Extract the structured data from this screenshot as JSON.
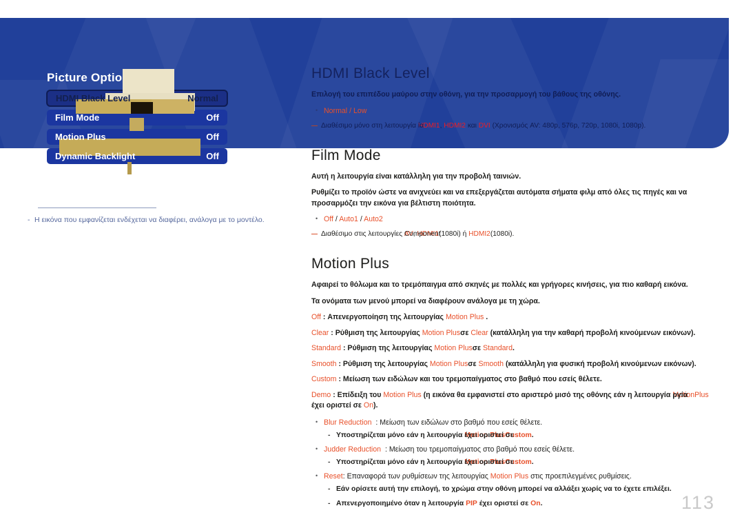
{
  "page": {
    "number": "113"
  },
  "osd": {
    "title": "Picture Options",
    "rows": [
      {
        "label": "HDMI Black Level",
        "value": "Normal",
        "selected": true
      },
      {
        "label": "Film Mode",
        "value": "Off",
        "selected": false
      },
      {
        "label": "Motion Plus",
        "value": "Off",
        "selected": false
      },
      {
        "label": "Dynamic Backlight",
        "value": "Off",
        "selected": false
      }
    ]
  },
  "left_note": {
    "dash": "-",
    "text": "Η εικόνα που εμφανίζεται ενδέχεται να διαφέρει, ανάλογα με το μοντέλο."
  },
  "sections": {
    "hdmi_black_level": {
      "heading": "HDMI Black Level",
      "intro": "Επιλογή του επιπέδου μαύρου στην οθόνη, για την προσαρμογή του βάθους της οθόνης.",
      "options": "Normal / Low",
      "options_1": "Normal",
      "options_sep": " / ",
      "options_2": "Low",
      "footnote_pre": "Διαθέσιμο μόνο στη λειτουργία ",
      "footnote_overlap_a": "HDMI1",
      "footnote_overlap_b": "ία",
      "footnote_mid": ", ",
      "footnote_hdmi2": "HDMI2",
      "footnote_kai": " και ",
      "footnote_dvi": "DVI",
      "footnote_tail": " (Χρονισμός AV: 480p, 576p, 720p, 1080i, 1080p)."
    },
    "film_mode": {
      "heading": "Film Mode",
      "p1": "Αυτή η λειτουργία είναι κατάλληλη για την προβολή ταινιών.",
      "p2": "Ρυθμίζει το προϊόν ώστε να ανιχνεύει και να επεξεργάζεται αυτόματα σήματα φιλμ από όλες τις πηγές και να προσαρμόζει την εικόνα για βέλτιστη ποιότητα.",
      "opt_off": "Off",
      "opt_sep": " / ",
      "opt_auto1": "Auto1",
      "opt_auto2": "Auto2",
      "footnote_pre": "Διαθέσιμο στις λειτουργίες ",
      "footnote_av": "AV",
      "footnote_component": "Component",
      "footnote_comma": ", ",
      "footnote_hdmi1": "HDMI1",
      "footnote_1080i_a": "(1080i) ή ",
      "footnote_hdmi2": "HDMI2",
      "footnote_1080i_b": "(1080i)."
    },
    "motion_plus": {
      "heading": "Motion Plus",
      "p1": "Αφαιρεί το θόλωμα και το τρεμόπαιγμα από σκηνές με πολλές και γρήγορες κινήσεις, για πιο καθαρή εικόνα.",
      "p2": "Τα ονόματα των μενού μπορεί να διαφέρουν ανάλογα με τη χώρα.",
      "lines": [
        {
          "key": "Off",
          "mid": " : Απενεργοποίηση της λειτουργίας ",
          "ref": "Motion Plus",
          "tail": " ."
        },
        {
          "key": "Clear",
          "mid": " : Ρύθμιση της λειτουργίας ",
          "ref": "Motion Plus",
          "se": "σε ",
          "val": "Clear",
          "tail": " (κατάλληλη για την καθαρή προβολή κινούμενων εικόνων)."
        },
        {
          "key": "Standard",
          "mid": " : Ρύθμιση της λειτουργίας ",
          "ref": "Motion Plus",
          "se": "σε ",
          "val": "Standard",
          "tail": "."
        },
        {
          "key": "Smooth",
          "mid": " : Ρύθμιση της λειτουργίας ",
          "ref": "Motion Plus",
          "se": "σε ",
          "val": "Smooth",
          "tail": " (κατάλληλη για φυσική προβολή κινούμενων εικόνων)."
        },
        {
          "key": "Custom",
          "mid": " : Μείωση των ειδώλων και του τρεμοπαίγματος στο βαθμό που εσείς θέλετε.",
          "ref": "",
          "tail": ""
        }
      ],
      "demo": {
        "key": "Demo",
        "mid": " : Επίδειξη του ",
        "ref": "Motion Plus",
        "body": " (η εικόνα θα εμφανιστεί στο αριστερό μισό της οθόνης εάν η λειτουργία ",
        "ov_a": "Motion",
        "ov_b": "ργία",
        "ref2": "Plus",
        "body2": " έχει οριστεί σε ",
        "on": "On",
        "tail": ")."
      },
      "bullets": [
        {
          "head": "Blur Reduction",
          "text": ": Μείωση των ειδώλων στο βαθμό που εσείς θέλετε.",
          "sub_pre": "Υποστηρίζεται μόνο εάν η λειτουργία ",
          "sub_ref": "Motion Plus",
          "sub_mid": "έχει οριστεί σε ",
          "sub_val": "Custom",
          "sub_tail": "."
        },
        {
          "head": "Judder Reduction",
          "text": ": Μείωση του τρεμοπαίγματος στο βαθμό που εσείς θέλετε.",
          "sub_pre": "Υποστηρίζεται μόνο εάν η λειτουργία ",
          "sub_ref": "Motion Plus",
          "sub_mid": "έχει οριστεί σε ",
          "sub_val": "Custom",
          "sub_tail": "."
        }
      ],
      "reset": {
        "head": "Reset",
        "text_a": ": Επαναφορά των ρυθμίσεων της λειτουργίας ",
        "ref": "Motion Plus",
        "text_b": " στις προεπιλεγμένες ρυθμίσεις.",
        "sub1": "Εάν ορίσετε αυτή την επιλογή, το χρώμα στην οθόνη μπορεί να αλλάξει χωρίς να το έχετε επιλέξει.",
        "sub2_pre": "Απενεργοποιημένο όταν η λειτουργία ",
        "sub2_ov": "PIP",
        "sub2_mid": " έχει οριστεί σε ",
        "sub2_on": "On",
        "sub2_tail": "."
      }
    }
  },
  "colors": {
    "banner_blue": "#21409a",
    "osd_blue": "#1b36a0",
    "accent_red": "#e8502a",
    "bright_red": "#ed1c24",
    "note_blue": "#55679c",
    "page_number_gray": "#c9c9c9"
  }
}
